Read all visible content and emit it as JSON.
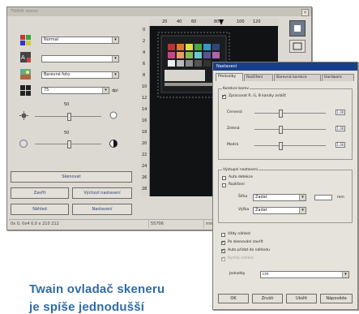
{
  "main_window": {
    "title": "TWAIN skener",
    "close_glyph": "×",
    "profile_combo": "Normal",
    "color_combo": "",
    "mode_combo": "Barevné foto",
    "resolution_combo": "75",
    "resolution_unit": "dpi",
    "brightness_value": "50",
    "contrast_value": "50",
    "buttons": {
      "scan": "Skenovat",
      "close": "Zavřít",
      "preview": "Náhled",
      "default": "Výchozí nastavení",
      "settings": "Nastavení"
    },
    "ruler_top": [
      "20",
      "40",
      "60",
      "80",
      "100",
      "120"
    ],
    "ruler_side": [
      "0",
      "2",
      "4",
      "6",
      "8",
      "10",
      "12",
      "14",
      "16",
      "18",
      "20",
      "22",
      "24",
      "26",
      "28"
    ],
    "status": {
      "coords": "0x 0, 0x4 0,0 x 210 212",
      "size": "55706",
      "unit": "mm"
    }
  },
  "settings_dialog": {
    "title": "Nastavení",
    "tabs": [
      "Předvolby",
      "Rozšíření",
      "Barevná korekce",
      "Hardware"
    ],
    "group_color": {
      "title": "Korekce barev",
      "option": "Zpracovat R, G, B kanály zvlášť",
      "labels": [
        "Červená",
        "Zelená",
        "Modrá"
      ],
      "values": [
        "1,00",
        "1,00",
        "1,00"
      ]
    },
    "group_output": {
      "title": "Výstupní nastavení",
      "check1": "Auto detekce",
      "check2": "Rozlišení",
      "sub_label1": "Šířka",
      "sub_label2": "Výška",
      "combo1": "Zadat",
      "combo2": "Zadat",
      "small_unit": "mm"
    },
    "options": [
      "Vždy náhled",
      "Po skenování zavřít",
      "Auto přidat do náhledu",
      "Rychlý náhled"
    ],
    "jednotky_label": "Jednotky",
    "jednotky_value": "cm",
    "buttons": {
      "ok": "OK",
      "cancel": "Zrušit",
      "apply": "Uložit",
      "help": "Nápověda"
    }
  },
  "caption": {
    "line1": "Twain ovladač skeneru",
    "line2": "je spíše jednodušší"
  },
  "colors": {
    "caption": "#2f6ba8",
    "button_text": "#2a3f7a",
    "dialog_title": "#1a3f8a"
  }
}
